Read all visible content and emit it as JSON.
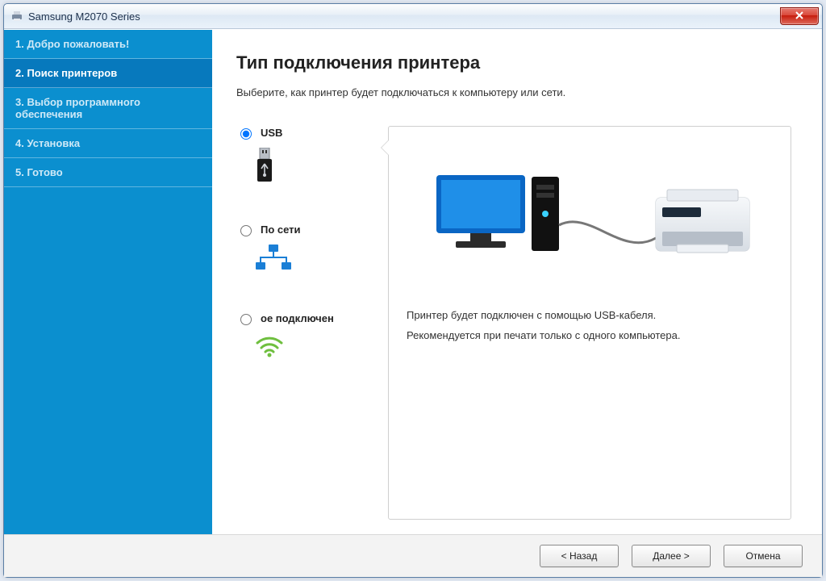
{
  "window": {
    "title": "Samsung M2070 Series"
  },
  "sidebar": {
    "steps": [
      {
        "label": "1. Добро пожаловать!"
      },
      {
        "label": "2. Поиск принтеров"
      },
      {
        "label": "3. Выбор программного обеспечения"
      },
      {
        "label": "4. Установка"
      },
      {
        "label": "5. Готово"
      }
    ]
  },
  "main": {
    "heading": "Тип подключения принтера",
    "subtitle": "Выберите, как принтер будет подключаться к компьютеру или сети."
  },
  "options": {
    "usb": {
      "label": "USB"
    },
    "network": {
      "label": "По сети"
    },
    "wifi": {
      "label": "ое подключен"
    }
  },
  "preview": {
    "line1": "Принтер будет подключен с помощью USB-кабеля.",
    "line2": "Рекомендуется при печати только с одного компьютера."
  },
  "footer": {
    "back": "< Назад",
    "next": "Далее >",
    "cancel": "Отмена"
  }
}
